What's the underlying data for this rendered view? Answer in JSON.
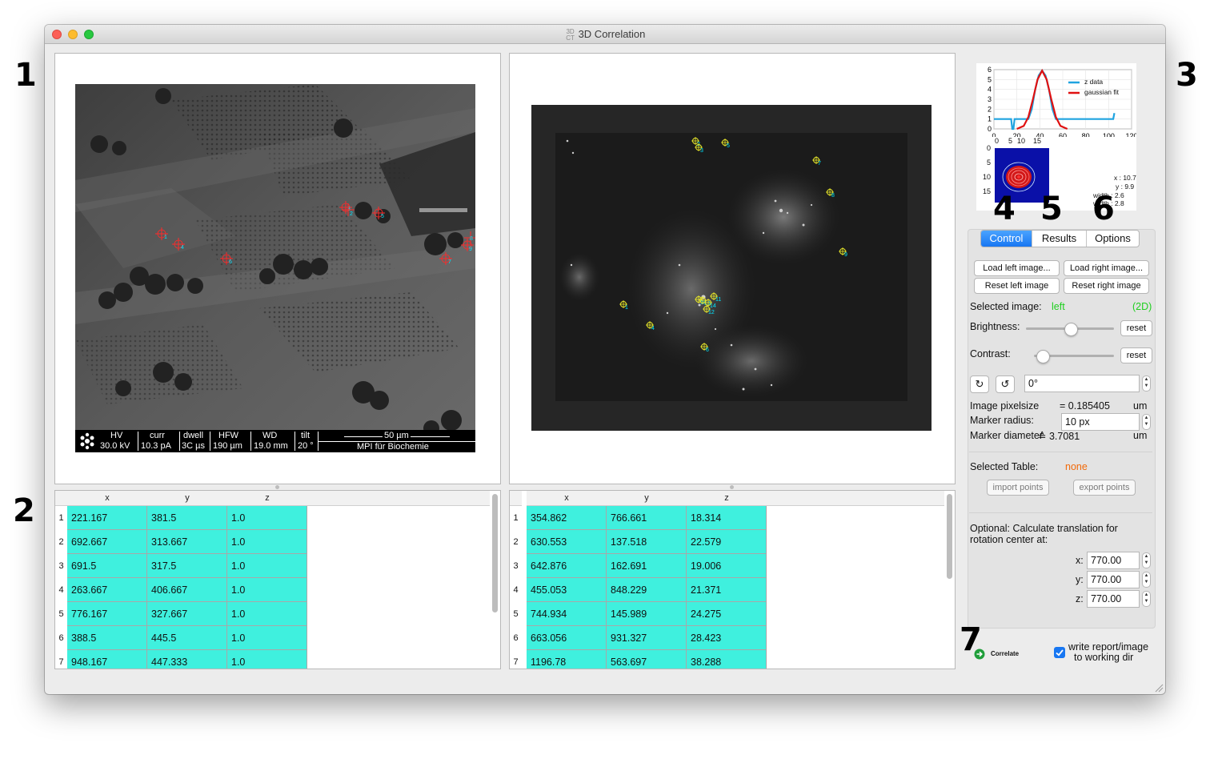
{
  "window": {
    "title": "3D Correlation",
    "title_icon_top": "3D",
    "title_icon_bottom": "CT"
  },
  "callouts": [
    "1",
    "2",
    "3",
    "4",
    "5",
    "6",
    "7"
  ],
  "sem_info": {
    "logo": "mpg-logo",
    "labels": [
      "HV",
      "curr",
      "dwell",
      "HFW",
      "WD",
      "tilt"
    ],
    "values": [
      "30.0 kV",
      "10.3 pA",
      "3C µs",
      "190 µm",
      "19.0 mm",
      "20 °"
    ],
    "scale": "50 µm",
    "institute": "MPI für Biochemie"
  },
  "left_markers": [
    "1",
    "2",
    "3",
    "4",
    "5",
    "6",
    "7",
    "8",
    "9"
  ],
  "right_markers": [
    "1",
    "2",
    "3",
    "4",
    "5",
    "6",
    "7",
    "8",
    "9",
    "10",
    "11",
    "12",
    "13",
    "14"
  ],
  "left_table": {
    "columns": [
      "x",
      "y",
      "z"
    ],
    "rows": [
      [
        "221.167",
        "381.5",
        "1.0"
      ],
      [
        "692.667",
        "313.667",
        "1.0"
      ],
      [
        "691.5",
        "317.5",
        "1.0"
      ],
      [
        "263.667",
        "406.667",
        "1.0"
      ],
      [
        "776.167",
        "327.667",
        "1.0"
      ],
      [
        "388.5",
        "445.5",
        "1.0"
      ],
      [
        "948.167",
        "447.333",
        "1.0"
      ]
    ]
  },
  "right_table": {
    "columns": [
      "x",
      "y",
      "z"
    ],
    "rows": [
      [
        "354.862",
        "766.661",
        "18.314"
      ],
      [
        "630.553",
        "137.518",
        "22.579"
      ],
      [
        "642.876",
        "162.691",
        "19.006"
      ],
      [
        "455.053",
        "848.229",
        "21.371"
      ],
      [
        "744.934",
        "145.989",
        "24.275"
      ],
      [
        "663.056",
        "931.327",
        "28.423"
      ],
      [
        "1196.78",
        "563.697",
        "38.288"
      ]
    ]
  },
  "gauss_plot": {
    "legend": [
      "z data",
      "gaussian fit"
    ],
    "colors": {
      "z_data": "#1fa3e0",
      "gaussian_fit": "#e01010"
    },
    "x_ticks": [
      "0",
      "20",
      "40",
      "60",
      "80",
      "100",
      "120"
    ],
    "y_ticks": [
      "0",
      "1",
      "2",
      "3",
      "4",
      "5",
      "6"
    ],
    "x_range": [
      0,
      120
    ],
    "y_range": [
      0,
      6
    ],
    "z_data": [
      [
        0,
        1
      ],
      [
        15,
        1
      ],
      [
        16,
        0
      ],
      [
        17,
        0
      ],
      [
        18,
        1
      ],
      [
        30,
        1
      ],
      [
        33,
        2
      ],
      [
        36,
        4
      ],
      [
        39,
        5.4
      ],
      [
        42,
        5.9
      ],
      [
        45,
        5.4
      ],
      [
        48,
        4
      ],
      [
        51,
        2
      ],
      [
        54,
        1
      ],
      [
        104,
        1
      ],
      [
        105,
        1.6
      ]
    ],
    "fit": [
      [
        20,
        0
      ],
      [
        26,
        0.3
      ],
      [
        30,
        1.2
      ],
      [
        34,
        3
      ],
      [
        38,
        5
      ],
      [
        42,
        5.9
      ],
      [
        46,
        5
      ],
      [
        50,
        3
      ],
      [
        54,
        1.2
      ],
      [
        58,
        0.3
      ],
      [
        64,
        0
      ]
    ]
  },
  "zoom_plot": {
    "x_ticks": [
      "0",
      "5",
      "10",
      "15"
    ],
    "y_ticks": [
      "0",
      "5",
      "10",
      "15"
    ],
    "stats": [
      "x : 10.7",
      "y : 9.9",
      "width : 2.6",
      "width : 2.8"
    ]
  },
  "tabs": [
    "Control",
    "Results",
    "Options"
  ],
  "active_tab": "Control",
  "control": {
    "load_left": "Load left image...",
    "load_right": "Load right image...",
    "reset_left": "Reset left image",
    "reset_right": "Reset right image",
    "selected_image_label": "Selected image:",
    "selected_image_value": "left",
    "selected_image_mode": "(2D)",
    "brightness_label": "Brightness:",
    "brightness_level": 0.5,
    "contrast_label": "Contrast:",
    "contrast_level": 0.1,
    "reset": "reset",
    "rotation_value": "0°",
    "pixelsize_label": "Image pixelsize",
    "pixelsize_value": "= 0.185405",
    "pixelsize_unit": "um",
    "marker_radius_label": "Marker radius:",
    "marker_radius_value": "10 px",
    "marker_diameter_label": "Marker diameter",
    "marker_diameter_value": "≙ 3.7081",
    "marker_diameter_unit": "um",
    "selected_table_label": "Selected Table:",
    "selected_table_value": "none",
    "import_points": "import points",
    "export_points": "export points",
    "optional_text_1": "Optional: Calculate translation for",
    "optional_text_2": "rotation center at:",
    "x_label": "x:",
    "x_value": "770.00",
    "y_label": "y:",
    "y_value": "770.00",
    "z_label": "z:",
    "z_value": "770.00"
  },
  "bottom": {
    "correlate": "Correlate",
    "write_report_1": "write report/image",
    "write_report_2": "to working dir",
    "write_report_checked": true
  },
  "colors": {
    "accent": "#1877f2",
    "green_text": "#1fcf1f",
    "orange_text": "#f26a0a",
    "table_cell": "#3ff0de",
    "marker_num": "#00e5ff"
  }
}
